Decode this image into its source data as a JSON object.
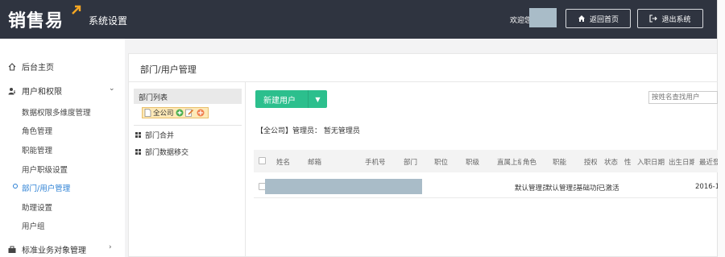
{
  "header": {
    "logo_text": "销售易",
    "subtitle": "系统设置",
    "welcome": "欢迎您",
    "home_button": "返回首页",
    "exit_button": "退出系统"
  },
  "sidebar": {
    "home": "后台主页",
    "users_permissions": "用户和权限",
    "sub_items": [
      "数据权限多维度管理",
      "角色管理",
      "职能管理",
      "用户职级设置",
      "部门/用户管理",
      "助理设置",
      "用户组"
    ],
    "active_index": 4,
    "business_objects": "标准业务对象管理"
  },
  "main": {
    "title": "部门/用户管理",
    "dept_list": "部门列表",
    "root_node": "全公司",
    "tools": [
      "部门合并",
      "部门数据移交"
    ],
    "new_user": "新建用户",
    "search_placeholder": "按姓名查找用户",
    "admin_line": "【全公司】管理员： 暂无管理员",
    "columns": [
      "姓名",
      "邮箱",
      "手机号",
      "部门",
      "职位",
      "职级",
      "直属上级",
      "角色",
      "职能",
      "授权",
      "状态",
      "性",
      "入职日期",
      "出生日期",
      "最近登录"
    ],
    "row": {
      "role": "默认管理员",
      "function": "默认管理员",
      "authorization": "基础功能",
      "status": "已激活",
      "last_login": "2016-1"
    }
  },
  "colors": {
    "topbar": "#2f3440",
    "accent_green": "#2cbf8d",
    "active_link": "#2a7fd4",
    "redaction": "#a9bcc8"
  }
}
